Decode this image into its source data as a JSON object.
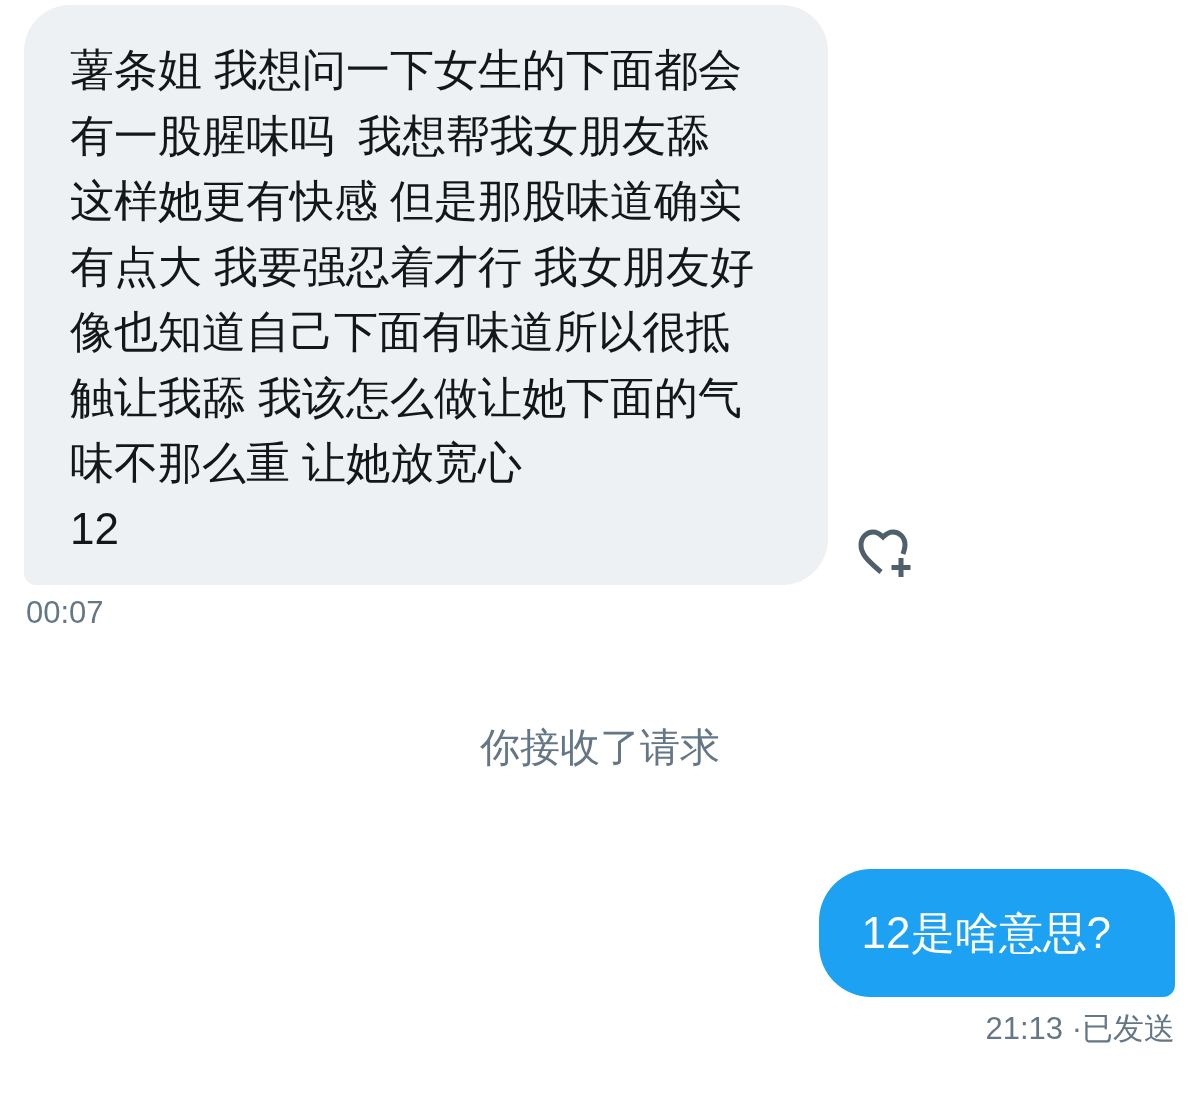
{
  "messages": [
    {
      "kind": "received",
      "lines": [
        "薯条姐 我想问一下女生的下面都会",
        "有一股腥味吗  我想帮我女朋友舔",
        "这样她更有快感 但是那股味道确实",
        "有点大 我要强忍着才行 我女朋友好",
        "像也知道自己下面有味道所以很抵",
        "触让我舔 我该怎么做让她下面的气",
        "味不那么重 让她放宽心",
        "12"
      ],
      "time": "00:07"
    },
    {
      "kind": "system",
      "text": "你接收了请求"
    },
    {
      "kind": "sent",
      "text": "12是啥意思?",
      "status": "21:13 ·已发送"
    }
  ]
}
